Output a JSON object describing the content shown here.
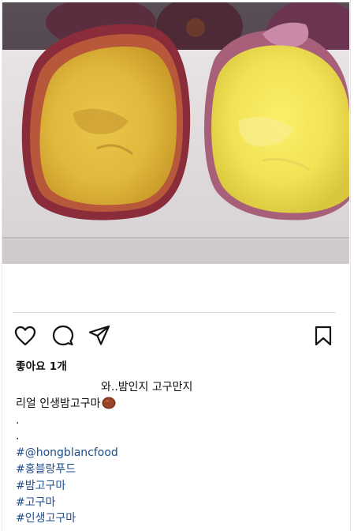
{
  "post": {
    "image_alt": "photo-of-two-halved-sweet-potatoes",
    "actions": {
      "like_icon": "heart-icon",
      "comment_icon": "comment-icon",
      "share_icon": "send-icon",
      "save_icon": "bookmark-icon"
    },
    "likes_text": "좋아요 1개",
    "caption": {
      "line1": "와..밤인지 고구만지",
      "line2": "리얼 인생밤고구마",
      "line2_emoji": "sweet-potato-emoji",
      "dot1": ".",
      "dot2": ".",
      "hashtags": [
        "#@hongblancfood",
        "#홍블랑푸드",
        "#밤고구마",
        "#고구마",
        "#인생고구마"
      ]
    },
    "colors": {
      "hashtag": "#1f4e8c",
      "text": "#111111",
      "divider": "#dcdcdc"
    }
  }
}
